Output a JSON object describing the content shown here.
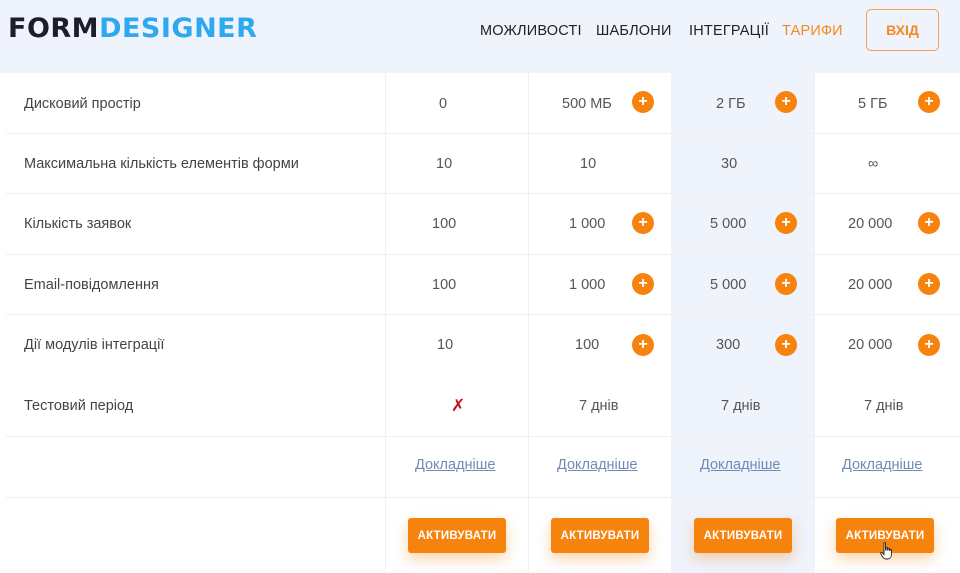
{
  "header": {
    "logo_part1": "FORM",
    "logo_part2": "DESIGNER",
    "nav": [
      "МОЖЛИВОСТІ",
      "ШАБЛОНИ",
      "ІНТЕГРАЦІЇ",
      "ТАРИФИ"
    ],
    "login_label": "ВХІД"
  },
  "colors": {
    "accent": "#f7830f",
    "brand_blue": "#2ea8ef",
    "highlight_bg": "#eef3fc",
    "link": "#6f8bb6",
    "cross": "#c8101c"
  },
  "rows": [
    {
      "label": "Дисковий простір",
      "values": [
        "0",
        "500 МБ",
        "2 ГБ",
        "5 ГБ"
      ]
    },
    {
      "label": "Максимальна кількість елементів форми",
      "values": [
        "10",
        "10",
        "30",
        "∞"
      ]
    },
    {
      "label": "Кількість заявок",
      "values": [
        "100",
        "1 000",
        "5 000",
        "20 000"
      ]
    },
    {
      "label": "Email-повідомлення",
      "values": [
        "100",
        "1 000",
        "5 000",
        "20 000"
      ]
    },
    {
      "label": "Дії модулів інтеграції",
      "values": [
        "10",
        "100",
        "300",
        "20 000"
      ]
    },
    {
      "label": "Тестовий період",
      "values": [
        "✗",
        "7 днів",
        "7 днів",
        "7 днів"
      ]
    }
  ],
  "plus_symbol": "+",
  "more_label": "Докладніше",
  "activate_label": "АКТИВУВАТИ"
}
